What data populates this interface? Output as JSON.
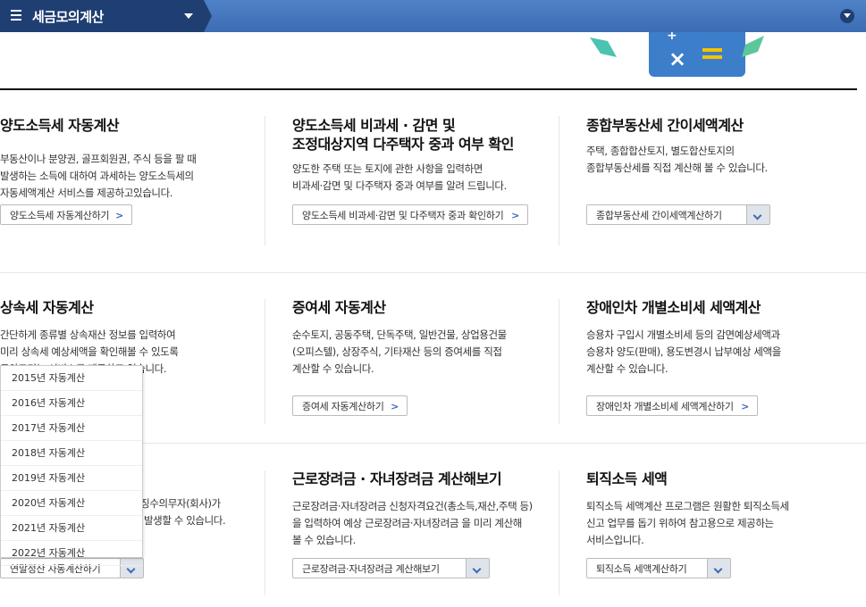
{
  "header": {
    "title": "세금모의계산",
    "icons": [
      "menu-icon",
      "caret-down-icon",
      "collapse-icon"
    ],
    "colors": {
      "bar": "#3c6cb3",
      "tab": "#1f3f73"
    }
  },
  "cards": [
    {
      "title_lines": [
        "양도소득세 자동계산"
      ],
      "desc_lines": [
        "부동산이나 분양권, 골프회원권, 주식 등을 팔 때",
        "발생하는 소득에 대하여 과세하는 양도소득세의",
        "자동세액계산 서비스를 제공하고있습니다."
      ],
      "button": "양도소득세 자동계산하기"
    },
    {
      "title_lines": [
        "양도소득세 비과세 · 감면 및",
        "조정대상지역 다주택자 중과 여부 확인"
      ],
      "desc_lines": [
        "양도한 주택 또는 토지에 관한 사항을 입력하면",
        "비과세·감면 및 다주택자 중과 여부를 알려 드립니다."
      ],
      "button": "양도소득세 비과세·감면 및 다주택자 중과 확인하기"
    },
    {
      "title_lines": [
        "종합부동산세 간이세액계산"
      ],
      "desc_lines": [
        "주택, 종합합산토지, 별도합산토지의",
        "종합부동산세를 직접 계산해 볼 수 있습니다."
      ],
      "button": "종합부동산세 간이세액계산하기"
    },
    {
      "title_lines": [
        "상속세 자동계산"
      ],
      "desc_lines": [
        "간단하게 종류별 상속재산 정보를 입력하여",
        "미리 상속세 예상세액을 확인해볼 수 있도록",
        "도와드리는 서비스를 제공하고 있습니다."
      ],
      "button": ""
    },
    {
      "title_lines": [
        "증여세 자동계산"
      ],
      "desc_lines": [
        "순수토지, 공동주택, 단독주택, 일반건물, 상업용건물",
        "(오피스텔), 상장주식, 기타재산 등의 증여세를 직접",
        "계산할 수 있습니다."
      ],
      "button": "증여세 자동계산하기"
    },
    {
      "title_lines": [
        "장애인차 개별소비세 세액계산"
      ],
      "desc_lines": [
        "승용차 구입시 개별소비세 등의 감면예상세액과",
        "승용차 양도(판매), 용도변경시 납부예상 세액을",
        "계산할 수 있습니다."
      ],
      "button": "장애인차 개별소비세 세액계산하기"
    },
    {
      "title_lines": [
        ""
      ],
      "desc_lines": [
        "천징수의무자(회사)가",
        "발생할 수 있습니다."
      ],
      "button": "연말정산 자동계산하기"
    },
    {
      "title_lines": [
        "근로장려금 · 자녀장려금 계산해보기"
      ],
      "desc_lines": [
        "근로장려금·자녀장려금 신청자격요건(총소득,재산,주택 등)",
        "을 입력하여 예상 근로장려금·자녀장려금 을 미리 계산해",
        "볼 수 있습니다."
      ],
      "button": "근로장려금·자녀장려금 계산해보기"
    },
    {
      "title_lines": [
        "퇴직소득 세액"
      ],
      "desc_lines": [
        "퇴직소득 세액계산 프로그램은 원활한 퇴직소득세",
        "신고 업무를 돕기 위하여 참고용으로 제공하는",
        "서비스입니다."
      ],
      "button": "퇴직소득 세액계산하기"
    }
  ],
  "dropdown": {
    "items": [
      "2015년 자동계산",
      "2016년 자동계산",
      "2017년 자동계산",
      "2018년 자동계산",
      "2019년 자동계산",
      "2020년 자동계산",
      "2021년 자동계산",
      "2022년 자동계산"
    ]
  }
}
